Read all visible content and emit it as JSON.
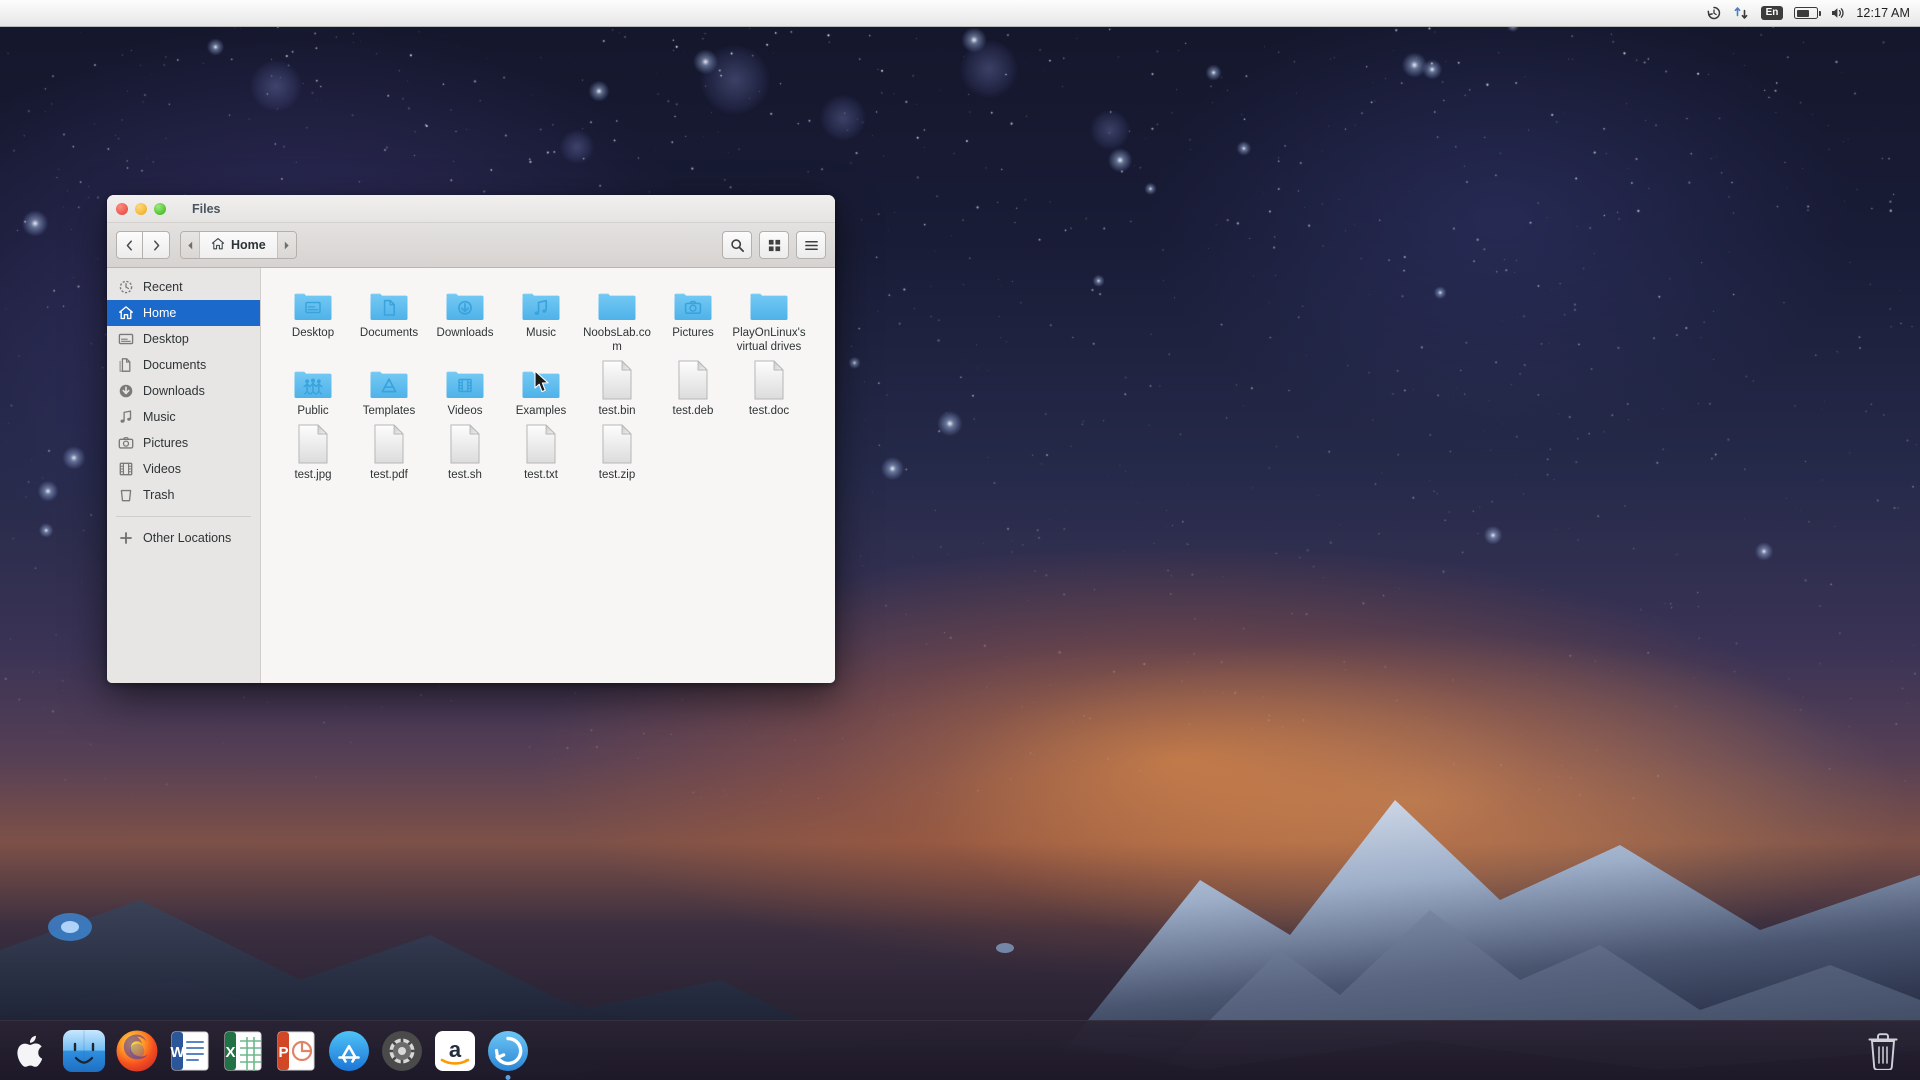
{
  "topbar": {
    "clock": "12:17 AM",
    "tray": [
      {
        "name": "history-icon",
        "glyph": "↺"
      },
      {
        "name": "network-icon",
        "glyph": "⇅"
      },
      {
        "name": "keyboard-layout-indicator",
        "label": "En"
      },
      {
        "name": "battery-icon",
        "glyph": ""
      },
      {
        "name": "volume-icon",
        "glyph": "🔊"
      }
    ]
  },
  "window": {
    "title": "Files",
    "traffic_lights": [
      {
        "name": "close-button",
        "color": "#ec5f55"
      },
      {
        "name": "minimize-button",
        "color": "#f5bc3e"
      },
      {
        "name": "maximize-button",
        "color": "#5dc73c"
      }
    ],
    "toolbar": {
      "back_label": "‹",
      "forward_label": "›",
      "path_prev_label": "◀",
      "path_next_label": "▶",
      "breadcrumb": "Home",
      "search_label": "search-icon",
      "grid_view_label": "grid-view-icon",
      "menu_label": "hamburger-menu-icon"
    }
  },
  "sidebar": {
    "items": [
      {
        "label": "Recent",
        "icon": "clock-icon",
        "selected": false
      },
      {
        "label": "Home",
        "icon": "home-icon",
        "selected": true
      },
      {
        "label": "Desktop",
        "icon": "desktop-icon",
        "selected": false
      },
      {
        "label": "Documents",
        "icon": "documents-icon",
        "selected": false
      },
      {
        "label": "Downloads",
        "icon": "download-icon",
        "selected": false
      },
      {
        "label": "Music",
        "icon": "music-icon",
        "selected": false
      },
      {
        "label": "Pictures",
        "icon": "camera-icon",
        "selected": false
      },
      {
        "label": "Videos",
        "icon": "film-icon",
        "selected": false
      },
      {
        "label": "Trash",
        "icon": "trash-icon",
        "selected": false
      }
    ],
    "other_locations": {
      "label": "Other Locations",
      "icon": "plus-icon"
    }
  },
  "files": [
    {
      "name": "Desktop",
      "type": "folder",
      "icon": "folder-desktop-icon"
    },
    {
      "name": "Documents",
      "type": "folder",
      "icon": "folder-documents-icon"
    },
    {
      "name": "Downloads",
      "type": "folder",
      "icon": "folder-downloads-icon"
    },
    {
      "name": "Music",
      "type": "folder",
      "icon": "folder-music-icon"
    },
    {
      "name": "NoobsLab.com",
      "type": "folder",
      "icon": "folder-icon"
    },
    {
      "name": "Pictures",
      "type": "folder",
      "icon": "folder-pictures-icon"
    },
    {
      "name": "PlayOnLinux's virtual drives",
      "type": "folder",
      "icon": "folder-icon"
    },
    {
      "name": "Public",
      "type": "folder",
      "icon": "folder-public-icon"
    },
    {
      "name": "Templates",
      "type": "folder",
      "icon": "folder-templates-icon"
    },
    {
      "name": "Videos",
      "type": "folder",
      "icon": "folder-videos-icon"
    },
    {
      "name": "Examples",
      "type": "folder",
      "icon": "folder-icon"
    },
    {
      "name": "test.bin",
      "type": "file",
      "icon": "document-icon"
    },
    {
      "name": "test.deb",
      "type": "file",
      "icon": "document-icon"
    },
    {
      "name": "test.doc",
      "type": "file",
      "icon": "document-icon"
    },
    {
      "name": "test.jpg",
      "type": "file",
      "icon": "document-icon"
    },
    {
      "name": "test.pdf",
      "type": "file",
      "icon": "document-icon"
    },
    {
      "name": "test.sh",
      "type": "file",
      "icon": "document-icon"
    },
    {
      "name": "test.txt",
      "type": "file",
      "icon": "document-icon"
    },
    {
      "name": "test.zip",
      "type": "file",
      "icon": "document-icon"
    }
  ],
  "dock": {
    "apps": [
      {
        "name": "apple-menu-icon",
        "label": "Apple",
        "running": false
      },
      {
        "name": "finder-icon",
        "label": "Finder",
        "running": false
      },
      {
        "name": "firefox-icon",
        "label": "Firefox",
        "running": false
      },
      {
        "name": "word-icon",
        "label": "Word",
        "running": false
      },
      {
        "name": "excel-icon",
        "label": "Excel",
        "running": false
      },
      {
        "name": "powerpoint-icon",
        "label": "PowerPoint",
        "running": false
      },
      {
        "name": "app-store-icon",
        "label": "App Store",
        "running": false
      },
      {
        "name": "settings-icon",
        "label": "Settings",
        "running": false
      },
      {
        "name": "amazon-icon",
        "label": "Amazon",
        "running": false
      },
      {
        "name": "files-icon",
        "label": "Files",
        "running": true
      }
    ],
    "trash": {
      "name": "trash-icon",
      "label": "Trash"
    }
  },
  "colors": {
    "accent": "#1b6acb",
    "folder": "#60bdf0",
    "window_bg": "#f7f6f5",
    "sidebar_bg": "#e8e6e4"
  }
}
